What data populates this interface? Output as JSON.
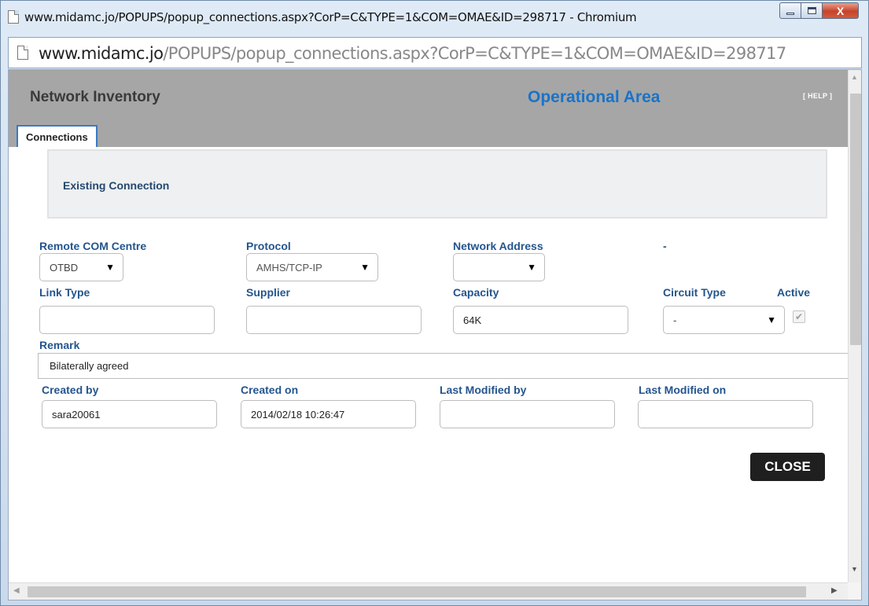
{
  "window": {
    "title": "www.midamc.jo/POPUPS/popup_connections.aspx?CorP=C&TYPE=1&COM=OMAE&ID=298717 - Chromium",
    "close_glyph": "X"
  },
  "address": {
    "host": "www.midamc.jo",
    "path": "/POPUPS/popup_connections.aspx?CorP=C&TYPE=1&COM=OMAE&ID=298717"
  },
  "header": {
    "app_title": "Network Inventory",
    "area_title": "Operational Area",
    "help_label": "[ HELP ]"
  },
  "tabs": [
    {
      "label": "Connections",
      "active": true
    }
  ],
  "panel": {
    "title": "Existing Connection"
  },
  "form": {
    "remote_com_centre": {
      "label": "Remote COM Centre",
      "value": "OTBD"
    },
    "protocol": {
      "label": "Protocol",
      "value": "AMHS/TCP-IP"
    },
    "network_address": {
      "label": "Network Address",
      "value": "",
      "extra": "-"
    },
    "link_type": {
      "label": "Link Type",
      "value": ""
    },
    "supplier": {
      "label": "Supplier",
      "value": ""
    },
    "capacity": {
      "label": "Capacity",
      "value": "64K"
    },
    "circuit_type": {
      "label": "Circuit Type",
      "value": "-"
    },
    "active": {
      "label": "Active",
      "checked": true,
      "glyph": "✔"
    },
    "remark": {
      "label": "Remark",
      "value": "Bilaterally agreed"
    },
    "created_by": {
      "label": "Created by",
      "value": "sara20061"
    },
    "created_on": {
      "label": "Created on",
      "value": "2014/02/18 10:26:47"
    },
    "last_modified_by": {
      "label": "Last Modified by",
      "value": ""
    },
    "last_modified_on": {
      "label": "Last Modified on",
      "value": ""
    }
  },
  "buttons": {
    "close_label": "CLOSE"
  },
  "glyphs": {
    "dropdown_arrow": "▼",
    "scroll_up": "▲",
    "scroll_down": "▼",
    "scroll_left": "◀",
    "scroll_right": "▶"
  },
  "colors": {
    "accent_blue": "#1a73c8",
    "label_blue": "#24558e",
    "header_gray": "#a6a6a6",
    "button_dark": "#1f1f1f"
  }
}
